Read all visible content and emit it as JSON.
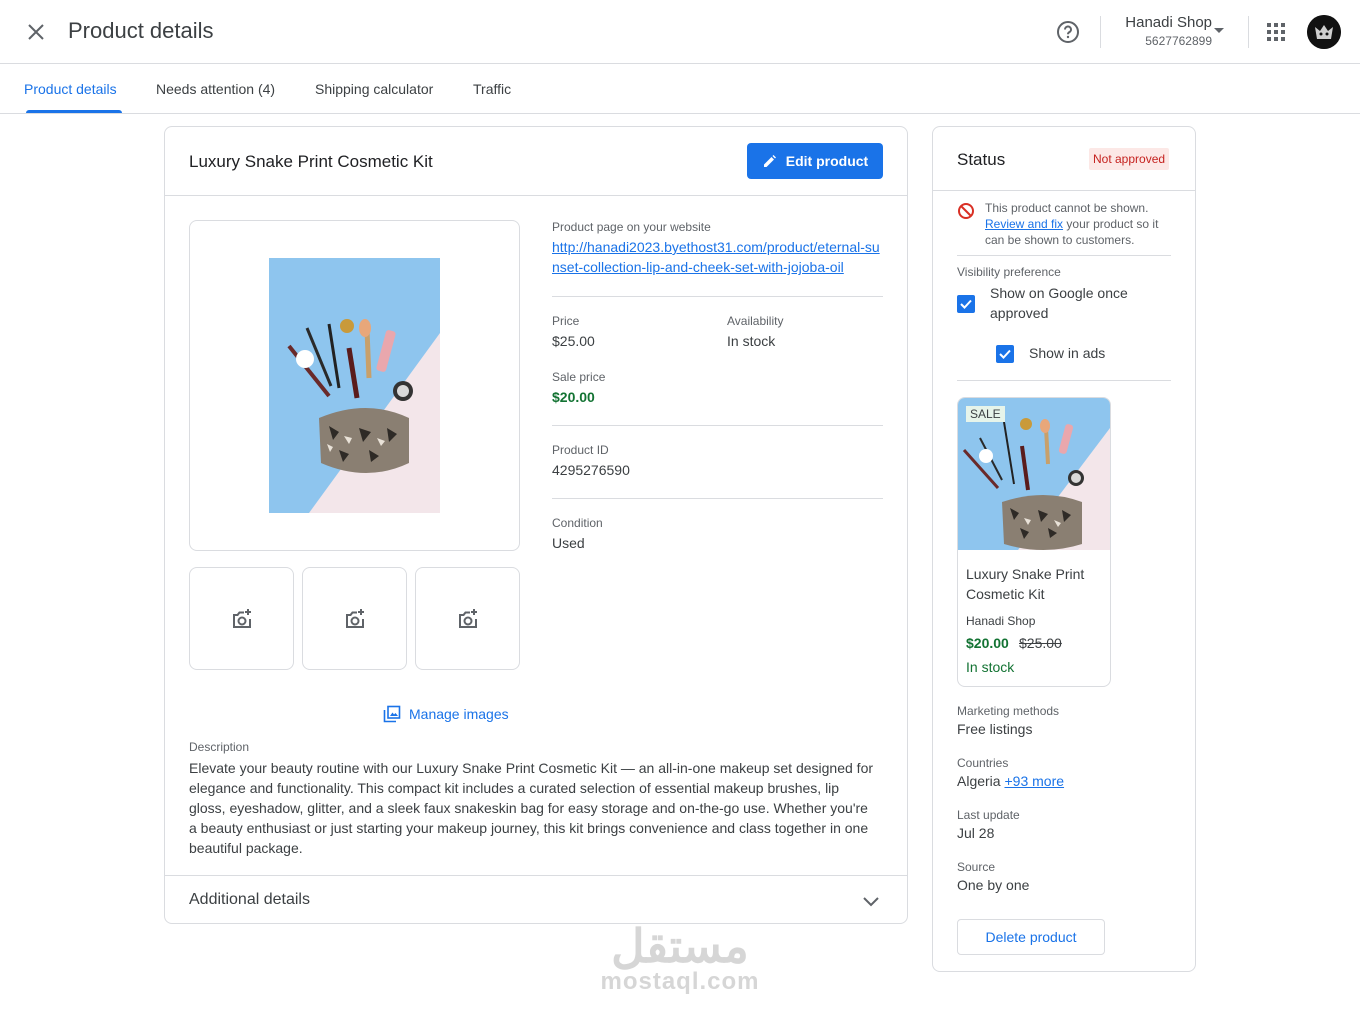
{
  "header": {
    "title": "Product details",
    "account_name": "Hanadi Shop",
    "account_id": "5627762899"
  },
  "tabs": [
    {
      "label": "Product details",
      "active": true
    },
    {
      "label": "Needs attention (4)",
      "active": false
    },
    {
      "label": "Shipping calculator",
      "active": false
    },
    {
      "label": "Traffic",
      "active": false
    }
  ],
  "product": {
    "title": "Luxury Snake Print Cosmetic Kit",
    "edit_label": "Edit product",
    "manage_images_label": "Manage images",
    "website_label": "Product page on your website",
    "website_url": "http://hanadi2023.byethost31.com/product/eternal-sunset-collection-lip-and-cheek-set-with-jojoba-oil",
    "price_label": "Price",
    "price": "$25.00",
    "availability_label": "Availability",
    "availability": "In stock",
    "sale_price_label": "Sale price",
    "sale_price": "$20.00",
    "product_id_label": "Product ID",
    "product_id": "4295276590",
    "condition_label": "Condition",
    "condition": "Used",
    "description_label": "Description",
    "description": "Elevate your beauty routine with our Luxury Snake Print Cosmetic Kit — an all-in-one makeup set designed for elegance and functionality. This compact kit includes a curated selection of essential makeup brushes, lip gloss, eyeshadow, glitter, and a sleek faux snakeskin bag for easy storage and on-the-go use. Whether you're a beauty enthusiast or just starting your makeup journey, this kit brings convenience and class together in one beautiful package.",
    "additional_label": "Additional details"
  },
  "status": {
    "title": "Status",
    "badge": "Not approved",
    "warning_pre": "This product cannot be shown.",
    "warning_link": "Review and fix",
    "warning_post": "your product so it can be shown to customers.",
    "visibility_label": "Visibility preference",
    "show_google_label": "Show on Google once approved",
    "show_ads_label": "Show in ads",
    "preview": {
      "sale_tag": "SALE",
      "title": "Luxury Snake Print Cosmetic Kit",
      "shop": "Hanadi Shop",
      "price": "$20.00",
      "old_price": "$25.00",
      "stock": "In stock"
    },
    "marketing_label": "Marketing methods",
    "marketing_value": "Free listings",
    "countries_label": "Countries",
    "countries_value": "Algeria",
    "countries_more": "+93 more",
    "last_update_label": "Last update",
    "last_update_value": "Jul 28",
    "source_label": "Source",
    "source_value": "One by one",
    "delete_label": "Delete product"
  },
  "watermark": {
    "arabic": "مستقل",
    "latin": "mostaql.com"
  },
  "colors": {
    "accent": "#1a73e8",
    "success": "#137333",
    "error": "#c5221f",
    "border": "#dadce0"
  },
  "icons": [
    "close-icon",
    "help-icon",
    "apps-grid-icon",
    "pencil-icon",
    "add-photo-icon",
    "image-library-icon",
    "chevron-down-icon",
    "ban-icon",
    "checkbox-checked-icon"
  ]
}
